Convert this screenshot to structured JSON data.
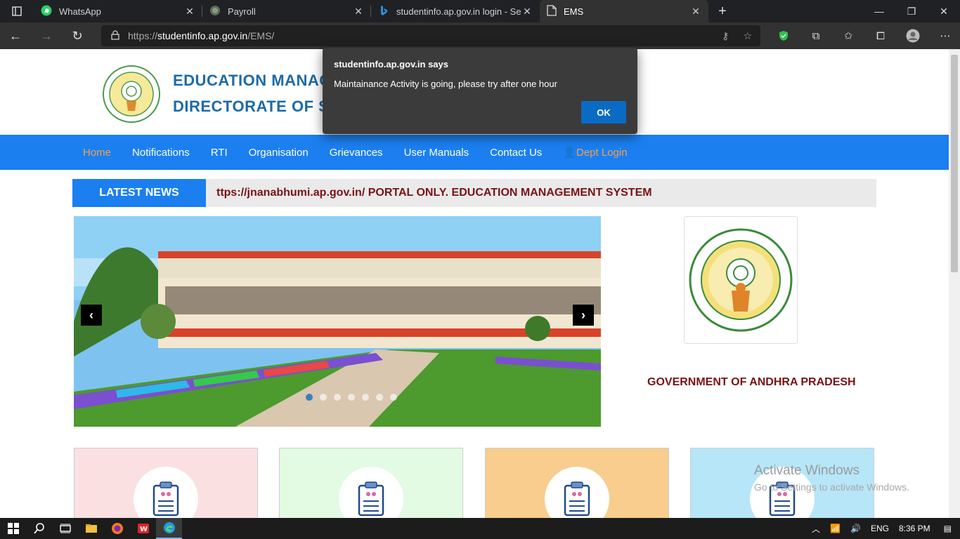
{
  "browser": {
    "tabs": [
      {
        "label": "WhatsApp",
        "icon": "whatsapp-icon"
      },
      {
        "label": "Payroll",
        "icon": "payroll-icon"
      },
      {
        "label": "studentinfo.ap.gov.in login - Sea",
        "icon": "bing-icon"
      },
      {
        "label": "EMS",
        "icon": "page-icon"
      }
    ],
    "url_prefix": "https://",
    "url_host": "studentinfo.ap.gov.in",
    "url_path": "/EMS/"
  },
  "header": {
    "title_line1": "EDUCATION MANAG",
    "title_line2": "DIRECTORATE OF SC"
  },
  "nav": {
    "items": [
      "Home",
      "Notifications",
      "RTI",
      "Organisation",
      "Grievances",
      "User Manuals",
      "Contact Us"
    ],
    "login": "Dept Login"
  },
  "news": {
    "label": "LATEST NEWS",
    "text": "ttps://jnanabhumi.ap.gov.in/ PORTAL ONLY. EDUCATION MANAGEMENT SYSTEM"
  },
  "sidebar": {
    "govt_label": "GOVERNMENT OF ANDHRA PRADESH"
  },
  "dialog": {
    "title": "studentinfo.ap.gov.in says",
    "message": "Maintainance Activity is going, please try after one hour",
    "ok": "OK"
  },
  "watermark": {
    "line1": "Activate Windows",
    "line2": "Go to Settings to activate Windows."
  },
  "taskbar": {
    "language": "ENG",
    "time": "8:36 PM"
  },
  "colors": {
    "nav_blue": "#1b7ff0",
    "header_blue": "#1d6aa8",
    "maroon": "#7a1212",
    "card_pink": "#fbe0e2",
    "card_green": "#e3fbe3",
    "card_orange": "#f8cd8d",
    "card_blue": "#b6e6f8"
  }
}
